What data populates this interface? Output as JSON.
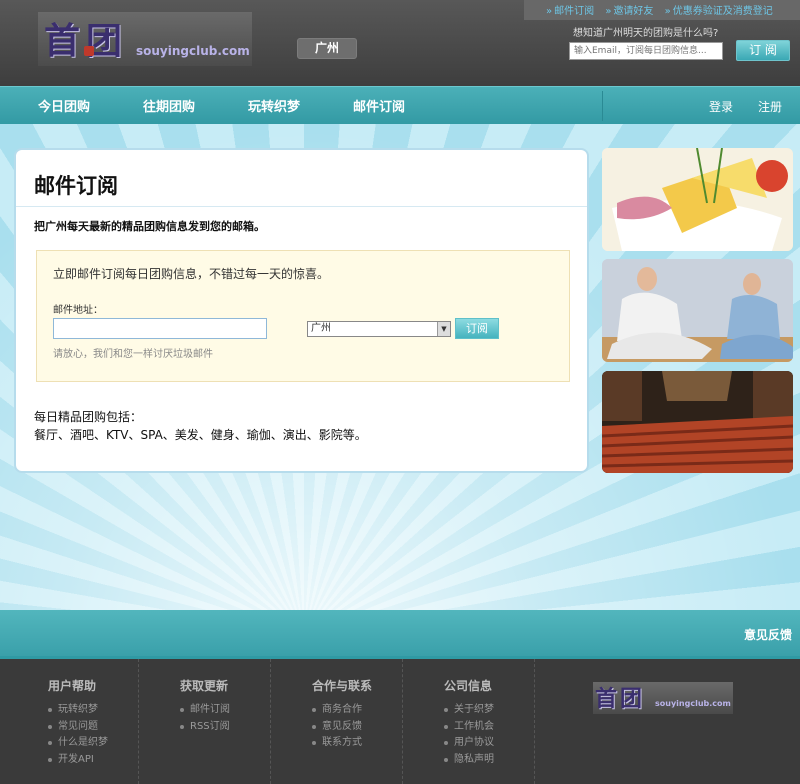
{
  "header": {
    "logo_text": "首团",
    "logo_domain": "souyingclub.com",
    "city": "广州",
    "toplinks": [
      "邮件订阅",
      "邀请好友",
      "优惠券验证及消费登记"
    ],
    "subscribe_question": "想知道广州明天的团购是什么吗?",
    "subscribe_placeholder": "输入Email，订阅每日团购信息...",
    "subscribe_button": "订 阅"
  },
  "nav": {
    "items": [
      "今日团购",
      "往期团购",
      "玩转织梦",
      "邮件订阅"
    ],
    "login": "登录",
    "register": "注册"
  },
  "main": {
    "title": "邮件订阅",
    "description": "把广州每天最新的精品团购信息发到您的邮箱。",
    "form": {
      "lead": "立即邮件订阅每日团购信息，不错过每一天的惊喜。",
      "email_label": "邮件地址：",
      "email_value": "",
      "city_selected": "广州",
      "submit": "订阅",
      "note": "请放心，我们和您一样讨厌垃圾邮件"
    },
    "daily_title": "每日精品团购包括：",
    "daily_list": "餐厅、酒吧、KTV、SPA、美发、健身、瑜伽、演出、影院等。"
  },
  "feedback": "意见反馈",
  "footer": {
    "columns": [
      {
        "title": "用户帮助",
        "items": [
          "玩转织梦",
          "常见问题",
          "什么是织梦",
          "开发API"
        ]
      },
      {
        "title": "获取更新",
        "items": [
          "邮件订阅",
          "RSS订阅"
        ]
      },
      {
        "title": "合作与联系",
        "items": [
          "商务合作",
          "意见反馈",
          "联系方式"
        ]
      },
      {
        "title": "公司信息",
        "items": [
          "关于织梦",
          "工作机会",
          "用户协议",
          "隐私声明"
        ]
      }
    ],
    "logo_text": "首团",
    "logo_domain": "souyingclub.com"
  },
  "colors": {
    "accent": "#3aa8b4",
    "header_bg": "#4a4a4a",
    "footer_bg": "#3a3a3a",
    "link": "#6ec6e6"
  }
}
